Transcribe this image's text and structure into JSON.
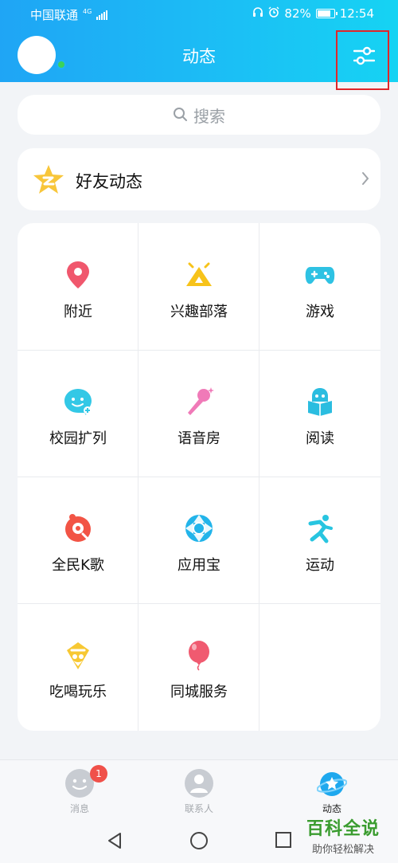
{
  "status": {
    "carrier": "中国联通",
    "network": "4G",
    "battery": "82%",
    "time": "12:54",
    "battery_level": 0.82
  },
  "header": {
    "title": "动态"
  },
  "search": {
    "placeholder": "搜索"
  },
  "friends_feed": {
    "label": "好友动态"
  },
  "grid": [
    {
      "label": "附近",
      "icon": "location-pin-icon",
      "color": "#f0576d"
    },
    {
      "label": "兴趣部落",
      "icon": "tent-icon",
      "color": "#f7c31a"
    },
    {
      "label": "游戏",
      "icon": "gamepad-icon",
      "color": "#2ec2e3"
    },
    {
      "label": "校园扩列",
      "icon": "chat-smile-icon",
      "color": "#33c8e6"
    },
    {
      "label": "语音房",
      "icon": "microphone-icon",
      "color": "#f07ab8"
    },
    {
      "label": "阅读",
      "icon": "book-reader-icon",
      "color": "#2bbde0"
    },
    {
      "label": "全民K歌",
      "icon": "karaoke-icon",
      "color": "#f25445"
    },
    {
      "label": "应用宝",
      "icon": "app-store-icon",
      "color": "#22b4ea"
    },
    {
      "label": "运动",
      "icon": "runner-icon",
      "color": "#28c5e0"
    },
    {
      "label": "吃喝玩乐",
      "icon": "ice-cream-icon",
      "color": "#f7c833"
    },
    {
      "label": "同城服务",
      "icon": "balloon-icon",
      "color": "#f05a70"
    }
  ],
  "bottom_nav": [
    {
      "label": "消息",
      "badge": "1",
      "active": false
    },
    {
      "label": "联系人",
      "active": false
    },
    {
      "label": "动态",
      "active": true
    }
  ],
  "watermark": {
    "title": "百科全说",
    "subtitle": "助你轻松解决"
  }
}
